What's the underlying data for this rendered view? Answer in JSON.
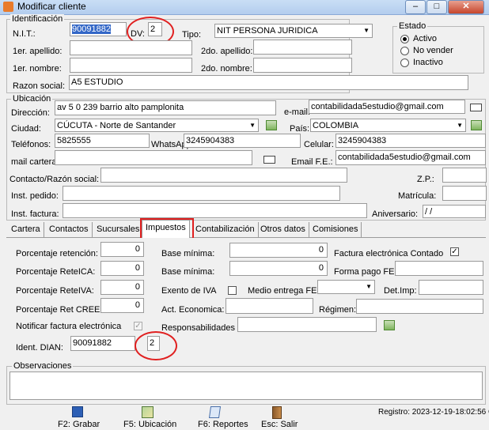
{
  "window": {
    "title": "Modificar cliente",
    "min": "–",
    "max": "□",
    "close": "✕"
  },
  "ident": {
    "group": "Identificación",
    "nit_label": "N.I.T.:",
    "nit": "90091882",
    "dv_label": "DV:",
    "dv": "2",
    "tipo_label": "Tipo:",
    "tipo": "NIT PERSONA JURIDICA",
    "ap1_label": "1er. apellido:",
    "ap2_label": "2do. apellido:",
    "nom1_label": "1er. nombre:",
    "nom2_label": "2do. nombre:",
    "razon_label": "Razon social:",
    "razon": "A5 ESTUDIO"
  },
  "estado": {
    "group": "Estado",
    "options": [
      "Activo",
      "No vender",
      "Inactivo"
    ],
    "selected": "Activo"
  },
  "ubic": {
    "group": "Ubicación",
    "dir_label": "Dirección:",
    "dir": "av 5 0 239 barrio alto pamplonita",
    "email_label": "e-mail:",
    "email": "contabilidada5estudio@gmail.com",
    "ciudad_label": "Ciudad:",
    "ciudad": "CÚCUTA - Norte de Santander",
    "pais_label": "País:",
    "pais": "COLOMBIA",
    "tel_label": "Teléfonos:",
    "tel": "5825555",
    "wa_label": "WhatsApp:",
    "wa": "3245904383",
    "cel_label": "Celular:",
    "cel": "3245904383",
    "mailcart_label": "mail cartera:",
    "emailfe_label": "Email F.E.:",
    "emailfe": "contabilidada5estudio@gmail.com",
    "contacto_label": "Contacto/Razón social:",
    "zp_label": "Z.P.:",
    "instped_label": "Inst. pedido:",
    "matricula_label": "Matrícula:",
    "instfac_label": "Inst. factura:",
    "aniv_label": "Aniversario:",
    "aniv": "  /  /"
  },
  "tabs": [
    "Cartera",
    "Contactos",
    "Sucursales",
    "Impuestos",
    "Contabilización",
    "Otros datos",
    "Comisiones"
  ],
  "imp": {
    "ret_label": "Porcentaje retención:",
    "ret": "0",
    "retica_label": "Porcentaje ReteICA:",
    "retica": "0",
    "retiva_label": "Porcentaje ReteIVA:",
    "retiva": "0",
    "cree_label": "Porcentaje Ret CREE:",
    "cree": "0",
    "base1_label": "Base mínima:",
    "base1": "0",
    "base2_label": "Base mínima:",
    "base2": "0",
    "exento_label": "Exento de IVA",
    "medio_label": "Medio entrega FE:",
    "actec_label": "Act. Economica:",
    "fec_label": "Factura electrónica Contado",
    "fec_check": "✓",
    "fpago_label": "Forma pago FE:",
    "detimp_label": "Det.Imp:",
    "regimen_label": "Régimen:",
    "notif_label": "Notificar factura electrónica",
    "notif_check": "✓",
    "resp_label": "Responsabilidades",
    "dian_label": "Ident. DIAN:",
    "dian": "90091882",
    "dian_dv": "2"
  },
  "obs": {
    "group": "Observaciones"
  },
  "footer": {
    "registro": "Registro: 2023-12-19-18:02:56 CA",
    "btn1": "F2: Grabar",
    "btn2": "F5: Ubicación",
    "btn3": "F6: Reportes",
    "btn4": "Esc: Salir"
  }
}
